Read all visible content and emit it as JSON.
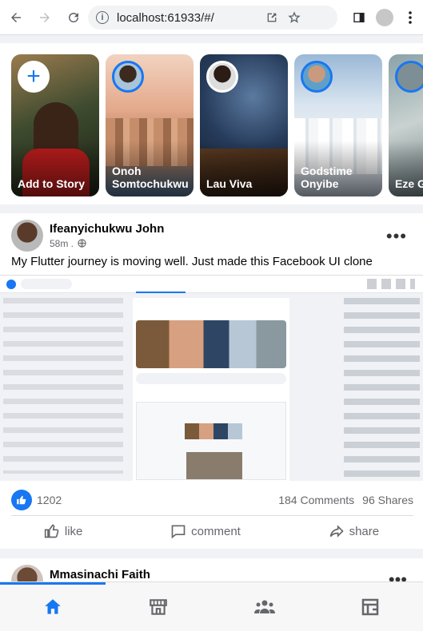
{
  "browser": {
    "url": "localhost:61933/#/",
    "info_icon": "i"
  },
  "stories": [
    {
      "label": "Add to Story",
      "type": "add"
    },
    {
      "label": "Onoh Somtochukwu",
      "type": "user"
    },
    {
      "label": "Lau Viva",
      "type": "user"
    },
    {
      "label": "Godstime Onyibe",
      "type": "user"
    },
    {
      "label": "Eze G",
      "type": "user"
    }
  ],
  "post": {
    "author": "Ifeanyichukwu John",
    "time": "58m .",
    "caption": "My Flutter journey is moving well. Just made this Facebook UI clone",
    "likes": "1202",
    "comments": "184 Comments",
    "shares": "96 Shares",
    "more_label": "•••"
  },
  "actions": {
    "like": "like",
    "comment": "comment",
    "share": "share"
  },
  "post2": {
    "author": "Mmasinachi Faith"
  },
  "colors": {
    "primary": "#1877f2",
    "background": "#f0f2f5"
  }
}
